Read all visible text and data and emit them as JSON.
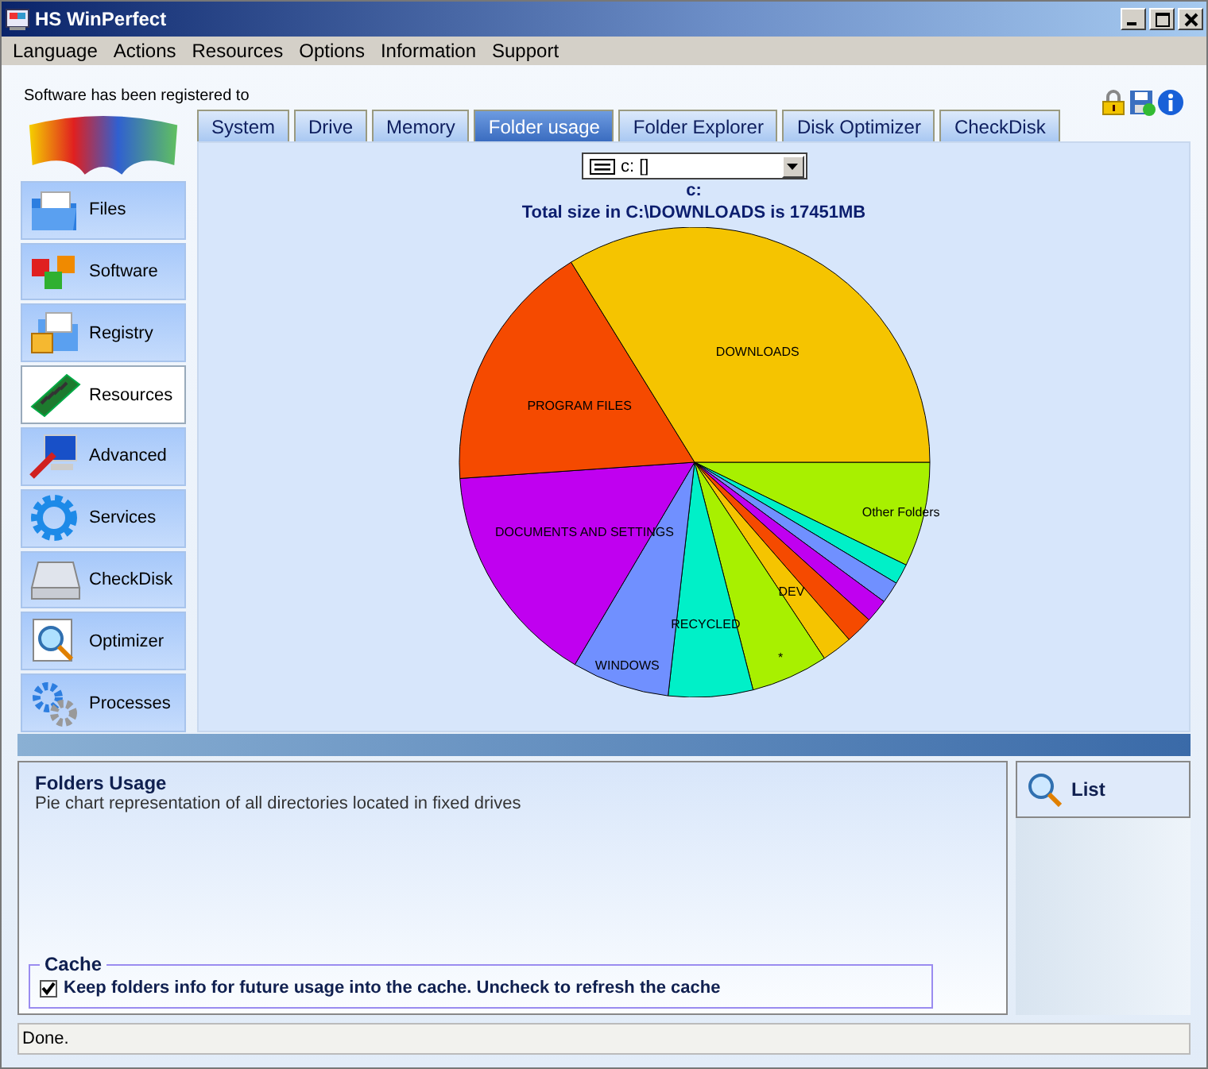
{
  "window": {
    "title": "HS WinPerfect"
  },
  "menu": [
    "Language",
    "Actions",
    "Resources",
    "Options",
    "Information",
    "Support"
  ],
  "registration": "Software has been registered to",
  "sidebar": {
    "items": [
      {
        "label": "Files",
        "selected": false
      },
      {
        "label": "Software",
        "selected": false
      },
      {
        "label": "Registry",
        "selected": false
      },
      {
        "label": "Resources",
        "selected": true
      },
      {
        "label": "Advanced",
        "selected": false
      },
      {
        "label": "Services",
        "selected": false
      },
      {
        "label": "CheckDisk",
        "selected": false
      },
      {
        "label": "Optimizer",
        "selected": false
      },
      {
        "label": "Processes",
        "selected": false
      }
    ]
  },
  "tabs": [
    {
      "label": "System",
      "selected": false
    },
    {
      "label": "Drive",
      "selected": false
    },
    {
      "label": "Memory",
      "selected": false
    },
    {
      "label": "Folder usage",
      "selected": true
    },
    {
      "label": "Folder Explorer",
      "selected": false
    },
    {
      "label": "Disk Optimizer",
      "selected": false
    },
    {
      "label": "CheckDisk",
      "selected": false
    }
  ],
  "drive_select": {
    "value": "c: []"
  },
  "chart_title": "c:",
  "chart_subtitle": "Total size in C:\\DOWNLOADS is 17451MB",
  "chart_data": {
    "type": "pie",
    "categories": [
      "Other Folders",
      null,
      null,
      null,
      null,
      "DEV",
      "*",
      "RECYCLED",
      "WINDOWS",
      "DOCUMENTS AND SETTINGS",
      "PROGRAM FILES",
      "DOWNLOADS"
    ],
    "values": [
      7.2,
      1.4,
      1.5,
      1.6,
      1.9,
      2.1,
      5.3,
      5.8,
      6.7,
      15.4,
      17.3,
      33.8
    ],
    "colors": [
      "#a8f000",
      "#00f0c8",
      "#7090ff",
      "#c000f0",
      "#f54a00",
      "#f5c400",
      "#a8f000",
      "#00f0c8",
      "#7090ff",
      "#c000f0",
      "#f54a00",
      "#f5c400"
    ]
  },
  "info": {
    "title": "Folders Usage",
    "description": "Pie chart representation of all directories located in fixed drives"
  },
  "cache": {
    "legend": "Cache",
    "label": "Keep folders info for future usage into the cache. Uncheck to refresh the cache",
    "checked": true
  },
  "list_button": "List",
  "status_bar": "Done."
}
